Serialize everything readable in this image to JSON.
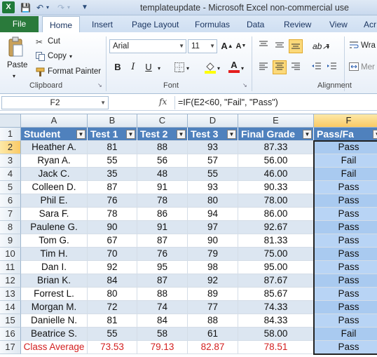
{
  "window": {
    "title": "templateupdate - Microsoft Excel non-commercial use"
  },
  "ribbon_tabs": [
    "File",
    "Home",
    "Insert",
    "Page Layout",
    "Formulas",
    "Data",
    "Review",
    "View",
    "Acr"
  ],
  "ribbon": {
    "clipboard": {
      "paste": "Paste",
      "cut": "Cut",
      "copy": "Copy",
      "format_painter": "Format Painter",
      "label": "Clipboard"
    },
    "font": {
      "family": "Arial",
      "size": "11",
      "label": "Font",
      "bold": "B",
      "italic": "I",
      "underline": "U"
    },
    "alignment": {
      "label": "Alignment",
      "wrap": "Wra",
      "merge": "Mer"
    }
  },
  "formula_bar": {
    "name_box": "F2",
    "fx": "fx",
    "formula": "=IF(E2<60, \"Fail\", \"Pass\")"
  },
  "grid": {
    "columns": [
      "A",
      "B",
      "C",
      "D",
      "E",
      "F"
    ],
    "row_numbers": [
      "1",
      "2",
      "3",
      "4",
      "5",
      "6",
      "7",
      "8",
      "9",
      "10",
      "11",
      "12",
      "13",
      "14",
      "15",
      "16",
      "17"
    ],
    "headers": [
      "Student",
      "Test 1",
      "Test 2",
      "Test 3",
      "Final Grade",
      "Pass/Fa"
    ],
    "rows": [
      [
        "Heather A.",
        "81",
        "88",
        "93",
        "87.33",
        "Pass"
      ],
      [
        "Ryan A.",
        "55",
        "56",
        "57",
        "56.00",
        "Fail"
      ],
      [
        "Jack C.",
        "35",
        "48",
        "55",
        "46.00",
        "Fail"
      ],
      [
        "Colleen D.",
        "87",
        "91",
        "93",
        "90.33",
        "Pass"
      ],
      [
        "Phil E.",
        "76",
        "78",
        "80",
        "78.00",
        "Pass"
      ],
      [
        "Sara F.",
        "78",
        "86",
        "94",
        "86.00",
        "Pass"
      ],
      [
        "Paulene G.",
        "90",
        "91",
        "97",
        "92.67",
        "Pass"
      ],
      [
        "Tom G.",
        "67",
        "87",
        "90",
        "81.33",
        "Pass"
      ],
      [
        "Tim H.",
        "70",
        "76",
        "79",
        "75.00",
        "Pass"
      ],
      [
        "Dan I.",
        "92",
        "95",
        "98",
        "95.00",
        "Pass"
      ],
      [
        "Brian K.",
        "84",
        "87",
        "92",
        "87.67",
        "Pass"
      ],
      [
        "Forrest L.",
        "80",
        "88",
        "89",
        "85.67",
        "Pass"
      ],
      [
        "Morgan M.",
        "72",
        "74",
        "77",
        "74.33",
        "Pass"
      ],
      [
        "Danielle N.",
        "81",
        "84",
        "88",
        "84.33",
        "Pass"
      ],
      [
        "Beatrice S.",
        "55",
        "58",
        "61",
        "58.00",
        "Fail"
      ]
    ],
    "average_row": [
      "Class Average",
      "73.53",
      "79.13",
      "82.87",
      "78.51",
      "Pass"
    ],
    "selected_cell": "F2",
    "colors": {
      "header_bg": "#4f81bd",
      "band_bg": "#dce6f1",
      "selection_bg": "#b8d4f5",
      "average_text": "#d31f1f"
    }
  }
}
